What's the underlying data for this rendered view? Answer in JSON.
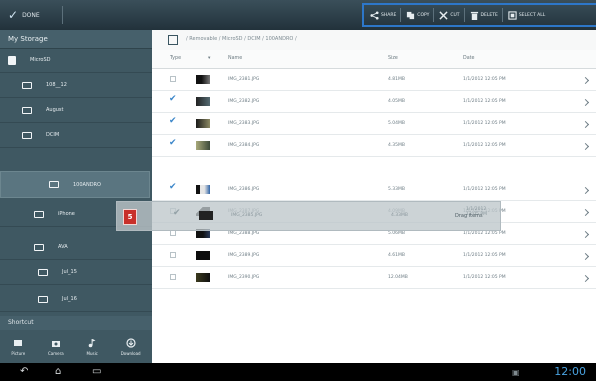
{
  "topbar": {
    "done_label": "DONE"
  },
  "actions": [
    {
      "label": "SHARE",
      "icon": "share-icon"
    },
    {
      "label": "COPY",
      "icon": "copy-icon"
    },
    {
      "label": "CUT",
      "icon": "cut-icon"
    },
    {
      "label": "DELETE",
      "icon": "delete-icon"
    },
    {
      "label": "SELECT ALL",
      "icon": "select-all-icon"
    }
  ],
  "sidebar": {
    "header": "My Storage",
    "items": [
      {
        "label": "MicroSD"
      },
      {
        "label": "108__12"
      },
      {
        "label": "August"
      },
      {
        "label": "DCIM"
      },
      {
        "label": "100ANDRO"
      },
      {
        "label": "iPhone"
      },
      {
        "label": "AVA"
      },
      {
        "label": "Jul_15"
      },
      {
        "label": "Jul_16"
      }
    ],
    "shortcut_header": "Shortcut",
    "shortcuts": [
      {
        "label": "Picture",
        "icon": "picture-icon"
      },
      {
        "label": "Camera",
        "icon": "camera-icon"
      },
      {
        "label": "Music",
        "icon": "music-icon"
      },
      {
        "label": "Download",
        "icon": "download-icon"
      }
    ]
  },
  "path": "/ Removable / MicroSD / DCIM / 100ANDRO /",
  "columns": {
    "type": "Type",
    "name": "Name",
    "size": "Size",
    "date": "Date"
  },
  "files": [
    {
      "name": "IMG_2381.JPG",
      "size": "4.81MB",
      "date": "1/1/2012 12:05 PM",
      "checked": false
    },
    {
      "name": "IMG_2382.JPG",
      "size": "4.05MB",
      "date": "1/1/2012 12:05 PM",
      "checked": true
    },
    {
      "name": "IMG_2383.JPG",
      "size": "5.04MB",
      "date": "1/1/2012 12:05 PM",
      "checked": true
    },
    {
      "name": "IMG_2384.JPG",
      "size": "4.35MB",
      "date": "1/1/2012 12:05 PM",
      "checked": true
    },
    {
      "name": "IMG_2385.JPG",
      "size": "4.33MB",
      "date": "1/1/2012 12:05 PM",
      "checked": true
    },
    {
      "name": "IMG_2386.JPG",
      "size": "5.33MB",
      "date": "1/1/2012 12:05 PM",
      "checked": true
    },
    {
      "name": "IMG_2387.JPG",
      "size": "4.09MB",
      "date": "1/1/2012 12:05 PM",
      "checked": false
    },
    {
      "name": "IMG_2388.JPG",
      "size": "5.06MB",
      "date": "1/1/2012 12:05 PM",
      "checked": false
    },
    {
      "name": "IMG_2389.JPG",
      "size": "4.61MB",
      "date": "1/1/2012 12:05 PM",
      "checked": false
    },
    {
      "name": "IMG_2390.JPG",
      "size": "12.04MB",
      "date": "1/1/2012 12:05 PM",
      "checked": false
    }
  ],
  "drag": {
    "badge": "5",
    "label": "Drag items"
  },
  "status": {
    "time": "12:00"
  }
}
